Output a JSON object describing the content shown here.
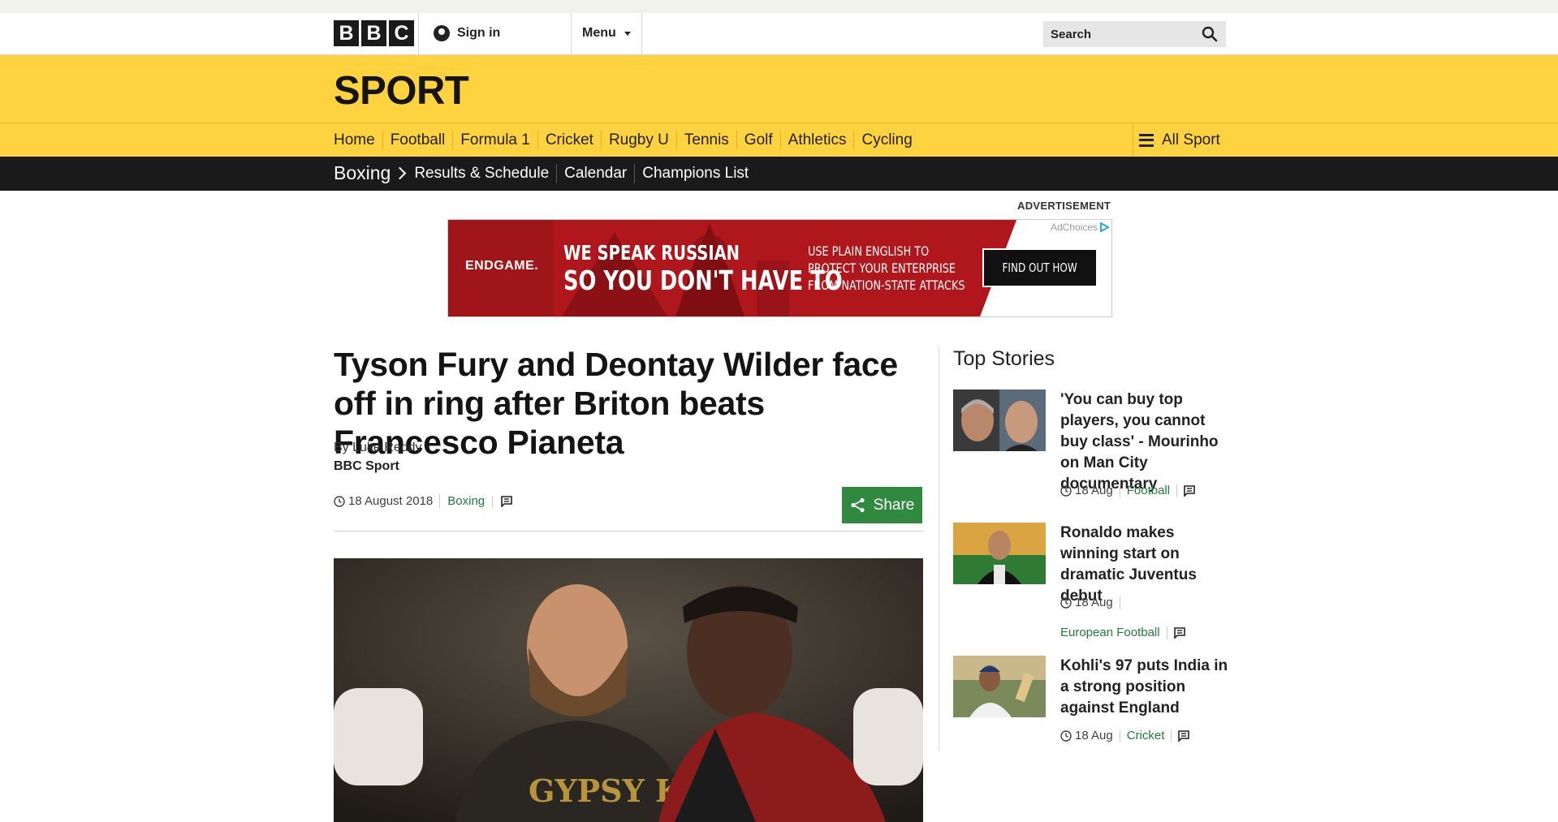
{
  "masthead": {
    "logo_letters": [
      "B",
      "B",
      "C"
    ],
    "signin_label": "Sign in",
    "menu_label": "Menu",
    "search_placeholder": "Search"
  },
  "sport": {
    "title": "SPORT",
    "nav": [
      "Home",
      "Football",
      "Formula 1",
      "Cricket",
      "Rugby U",
      "Tennis",
      "Golf",
      "Athletics",
      "Cycling"
    ],
    "all_sport_label": "All Sport"
  },
  "subnav": {
    "section": "Boxing",
    "links": [
      "Results & Schedule",
      "Calendar",
      "Champions List"
    ]
  },
  "ad": {
    "label": "ADVERTISEMENT",
    "brand": "ENDGAME.",
    "headline_1": "WE SPEAK RUSSIAN",
    "headline_2": "SO YOU DON'T HAVE TO",
    "sub_1": "USE PLAIN ENGLISH TO",
    "sub_2": "PROTECT YOUR ENTERPRISE",
    "sub_3": "FROM NATION-STATE ATTACKS",
    "cta": "FIND OUT HOW",
    "adchoices": "AdChoices"
  },
  "article": {
    "headline": "Tyson Fury and Deontay Wilder face off in ring after Briton beats Francesco Pianeta",
    "author": "By Luke Reddy",
    "org": "BBC Sport",
    "date": "18 August 2018",
    "category": "Boxing",
    "share_label": "Share"
  },
  "top_stories": {
    "title": "Top Stories",
    "items": [
      {
        "title": "'You can buy top players, you cannot buy class' - Mourinho on Man City documentary",
        "time": "18 Aug",
        "tag": "Football"
      },
      {
        "title": "Ronaldo makes winning start on dramatic Juventus debut",
        "time": "18 Aug",
        "tag": "European Football"
      },
      {
        "title": "Kohli's 97 puts India in a strong position against England",
        "time": "18 Aug",
        "tag": "Cricket"
      }
    ]
  },
  "colors": {
    "sport_yellow": "#ffd23f",
    "subnav_black": "#1a1a1a",
    "tag_green": "#227a3c",
    "share_green": "#2f8a3f"
  }
}
